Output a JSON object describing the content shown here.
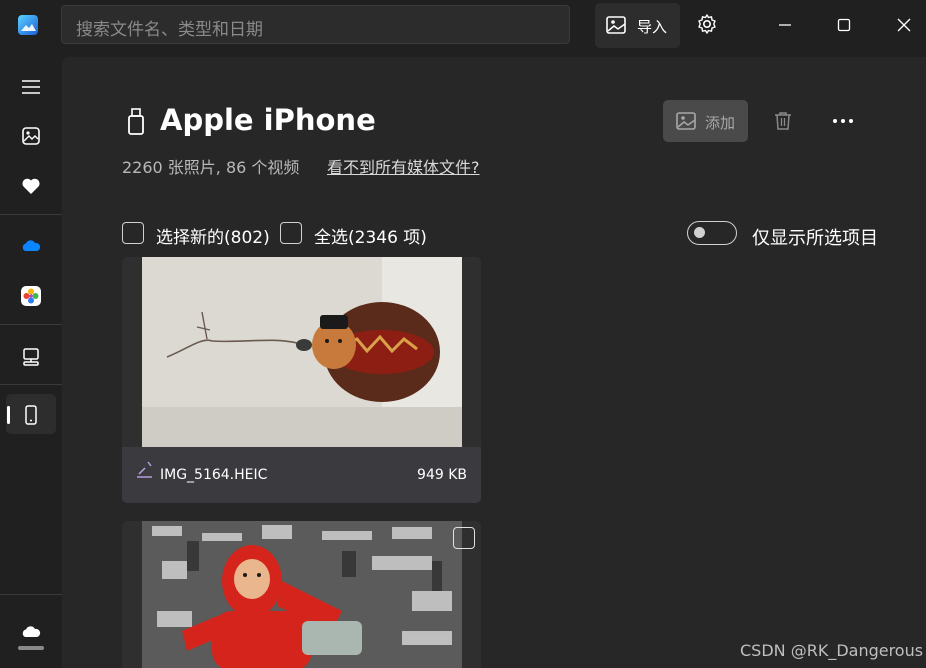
{
  "search": {
    "placeholder": "搜索文件名、类型和日期"
  },
  "header": {
    "import_label": "导入"
  },
  "sidebar": {
    "items": [
      "menu-icon",
      "gallery-icon",
      "favorites-icon",
      "onedrive-icon",
      "photos-icon",
      "this-pc-icon",
      "phone-icon",
      "cloud-icon"
    ]
  },
  "device": {
    "title": "Apple iPhone",
    "summary": "2260 张照片, 86 个视频",
    "missing_link": "看不到所有媒体文件?",
    "add_label": "添加"
  },
  "selection": {
    "select_new": "选择新的(802)",
    "select_all": "全选(2346 项)",
    "show_selected": "仅显示所选项目"
  },
  "items": [
    {
      "name": "IMG_5164.HEIC",
      "size": "949 KB"
    }
  ],
  "watermark": "CSDN @RK_Dangerous",
  "colors": {
    "background": "#202020",
    "content": "#272727",
    "card": "#2f2f2f",
    "accent_cloud": "#0a84ff"
  }
}
